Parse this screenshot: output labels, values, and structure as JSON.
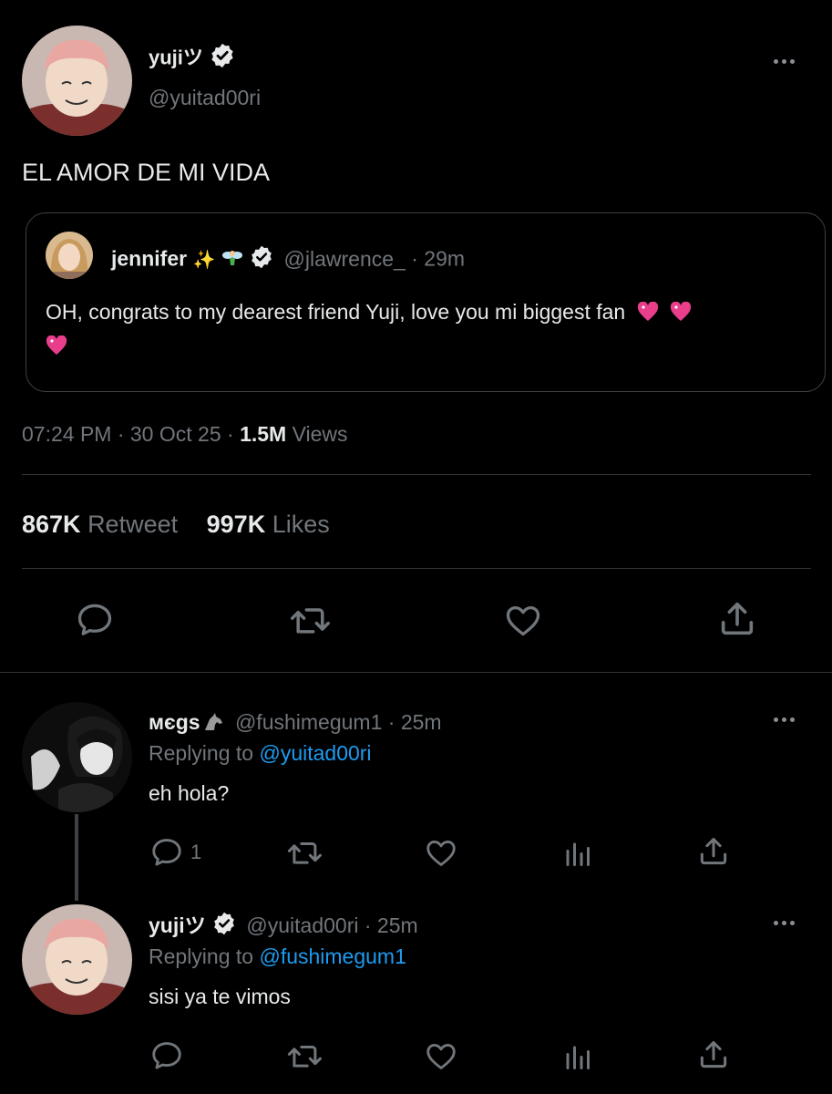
{
  "main_tweet": {
    "display_name": "yujiツ",
    "handle": "@yuitad00ri",
    "text": "EL AMOR DE MI VIDA",
    "quoted": {
      "display_name": "jennifer",
      "name_emojis": "✨",
      "handle": "@jlawrence_",
      "time": "· 29m",
      "text": "OH, congrats to my dearest friend Yuji, love you mi biggest fan"
    },
    "timestamp": "07:24 PM · 30 Oct 25",
    "views_count": "1.5M",
    "views_label": "Views",
    "retweets_count": "867K",
    "retweets_label": "Retweet",
    "likes_count": "997K",
    "likes_label": "Likes"
  },
  "replies": [
    {
      "display_name": "мєgs",
      "handle": "@fushimegum1",
      "time": "· 25m",
      "replying_prefix": "Replying to",
      "replying_to": "@yuitad00ri",
      "text": "eh hola?",
      "reply_count": "1"
    },
    {
      "display_name": "yujiツ",
      "handle": "@yuitad00ri",
      "time": "· 25m",
      "replying_prefix": "Replying to",
      "replying_to": "@fushimegum1",
      "text": "sisi ya te vimos"
    }
  ],
  "colors": {
    "background": "#000000",
    "text": "#e7e9ea",
    "muted": "#71767b",
    "link": "#1d9bf0",
    "divider": "#2f3336",
    "heart_pink": "#e83e8c"
  }
}
